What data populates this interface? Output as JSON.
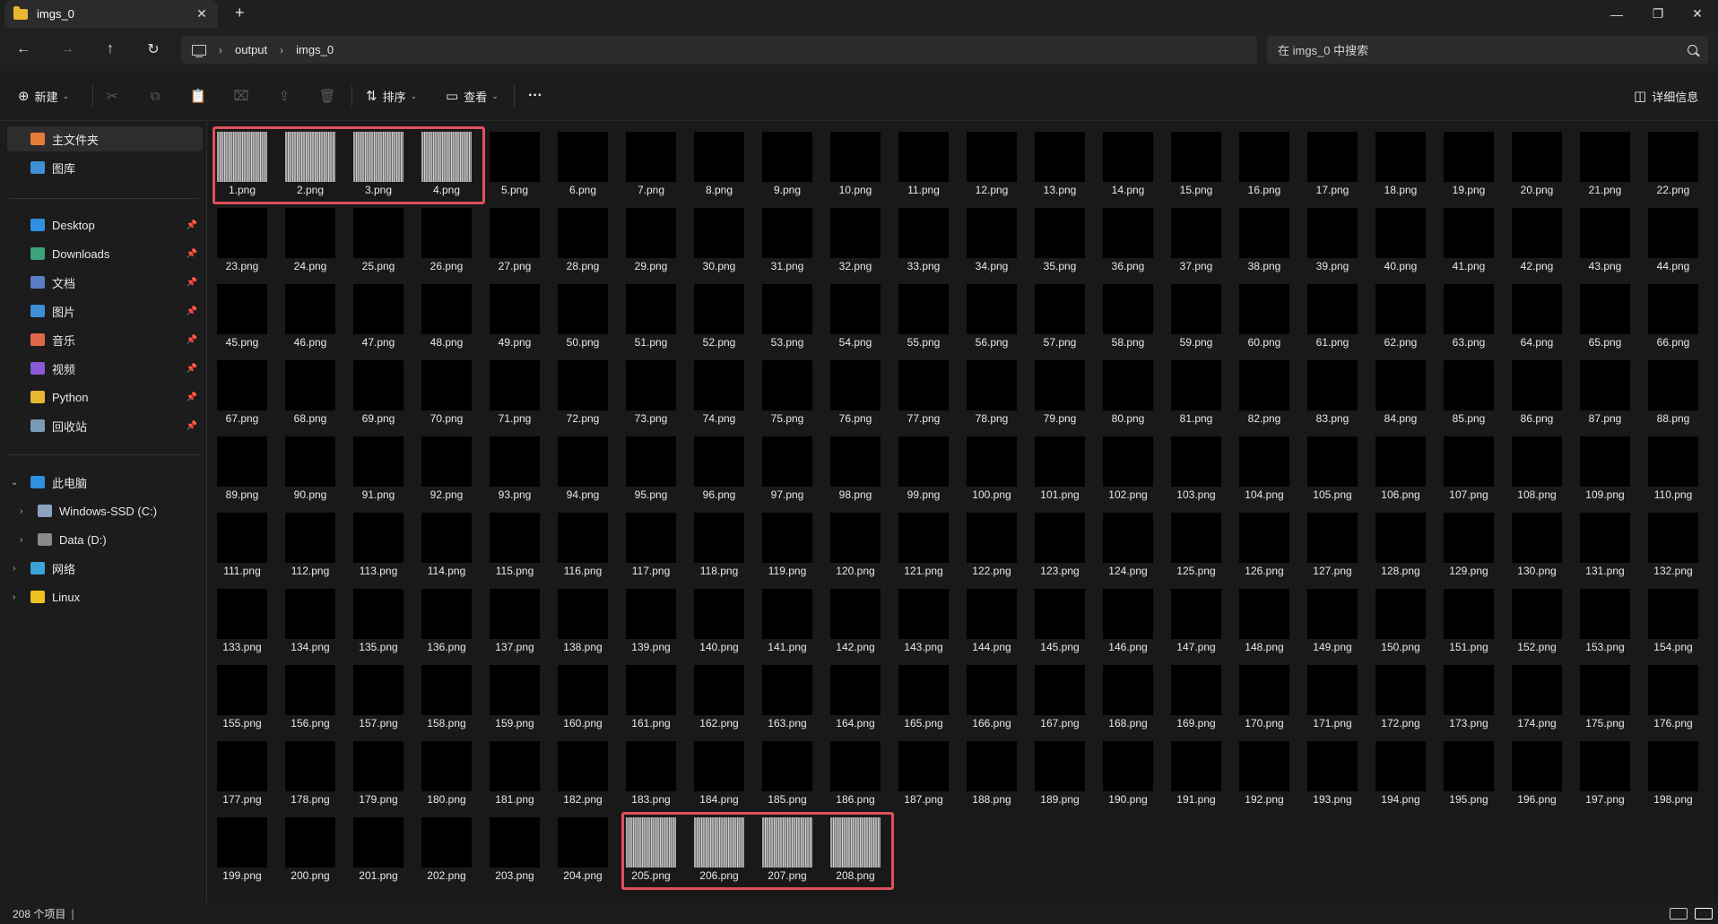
{
  "window": {
    "tab_title": "imgs_0",
    "tab_close": "✕",
    "new_tab": "+",
    "controls": {
      "minimize": "—",
      "maximize": "❐",
      "close": "✕"
    }
  },
  "nav": {
    "back": "←",
    "forward": "→",
    "up": "↑",
    "refresh": "↻",
    "breadcrumb": [
      "output",
      "imgs_0"
    ],
    "search_placeholder": "在 imgs_0 中搜索"
  },
  "toolbar": {
    "new_label": "新建",
    "sort_label": "排序",
    "view_label": "查看",
    "more": "···",
    "details_label": "详细信息"
  },
  "sidebar": {
    "home": "主文件夹",
    "gallery": "图库",
    "quick_access": [
      {
        "label": "Desktop",
        "color": "#2f8fe0"
      },
      {
        "label": "Downloads",
        "color": "#3ca37a"
      },
      {
        "label": "文档",
        "color": "#5a7ec4"
      },
      {
        "label": "图片",
        "color": "#3d8fd6"
      },
      {
        "label": "音乐",
        "color": "#e0684a"
      },
      {
        "label": "视频",
        "color": "#8a5ad6"
      },
      {
        "label": "Python",
        "color": "#e8b730"
      },
      {
        "label": "回收站",
        "color": "#7a9ab8"
      }
    ],
    "this_pc": "此电脑",
    "drives": [
      "Windows-SSD (C:)",
      "Data (D:)"
    ],
    "network": "网络",
    "linux": "Linux"
  },
  "files": {
    "count": 208,
    "suffix": ".png",
    "striped_thumbnails": [
      1,
      2,
      3,
      4,
      205,
      206,
      207,
      208
    ],
    "highlight_color": "#e0505b"
  },
  "status": {
    "item_count": "208 个项目"
  }
}
